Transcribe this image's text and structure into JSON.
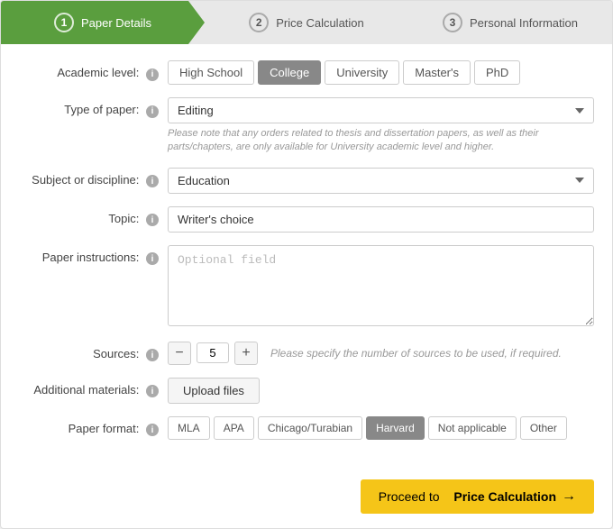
{
  "wizard": {
    "steps": [
      {
        "num": "1",
        "label": "Paper Details",
        "active": true
      },
      {
        "num": "2",
        "label": "Price Calculation",
        "active": false
      },
      {
        "num": "3",
        "label": "Personal Information",
        "active": false
      }
    ]
  },
  "form": {
    "academic_level": {
      "label": "Academic level:",
      "options": [
        "High School",
        "College",
        "University",
        "Master's",
        "PhD"
      ],
      "selected": "College"
    },
    "type_of_paper": {
      "label": "Type of paper:",
      "value": "Editing",
      "hint": "Please note that any orders related to thesis and dissertation papers, as well as their parts/chapters, are only available for University academic level and higher."
    },
    "subject": {
      "label": "Subject or discipline:",
      "value": "Education"
    },
    "topic": {
      "label": "Topic:",
      "placeholder": "",
      "value": "Writer's choice"
    },
    "instructions": {
      "label": "Paper instructions:",
      "placeholder": "Optional field"
    },
    "sources": {
      "label": "Sources:",
      "value": 5,
      "hint": "Please specify the number of sources to be used, if required."
    },
    "additional_materials": {
      "label": "Additional materials:",
      "upload_label": "Upload files"
    },
    "paper_format": {
      "label": "Paper format:",
      "options": [
        "MLA",
        "APA",
        "Chicago/Turabian",
        "Harvard",
        "Not applicable",
        "Other"
      ],
      "selected": "Harvard"
    }
  },
  "proceed": {
    "label": "Proceed to",
    "bold": "Price Calculation",
    "arrow": "→"
  },
  "icons": {
    "info": "i",
    "minus": "−",
    "plus": "+"
  }
}
